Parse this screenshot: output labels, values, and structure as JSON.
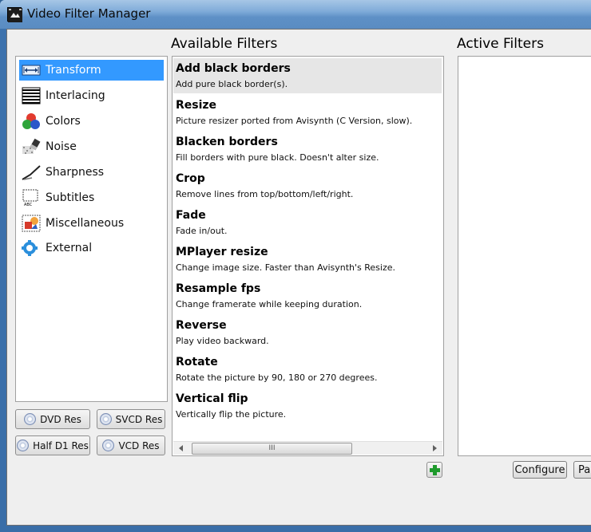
{
  "window": {
    "title": "Video Filter Manager"
  },
  "headings": {
    "available": "Available Filters",
    "active": "Active Filters"
  },
  "categories": [
    {
      "label": "Transform",
      "icon": "transform-icon",
      "selected": true
    },
    {
      "label": "Interlacing",
      "icon": "interlacing-icon"
    },
    {
      "label": "Colors",
      "icon": "colors-icon"
    },
    {
      "label": "Noise",
      "icon": "noise-icon"
    },
    {
      "label": "Sharpness",
      "icon": "sharpness-icon"
    },
    {
      "label": "Subtitles",
      "icon": "subtitles-icon"
    },
    {
      "label": "Miscellaneous",
      "icon": "miscellaneous-icon"
    },
    {
      "label": "External",
      "icon": "external-icon"
    }
  ],
  "res_buttons": {
    "dvd": "DVD Res",
    "svcd": "SVCD Res",
    "half_d1": "Half D1 Res",
    "vcd": "VCD Res"
  },
  "filters": [
    {
      "name": "Add black borders",
      "desc": "Add pure black border(s).",
      "selected": true
    },
    {
      "name": "Resize",
      "desc": "Picture resizer ported from Avisynth (C Version, slow)."
    },
    {
      "name": "Blacken borders",
      "desc": "Fill borders with pure black. Doesn't alter size."
    },
    {
      "name": "Crop",
      "desc": "Remove lines from top/bottom/left/right."
    },
    {
      "name": "Fade",
      "desc": "Fade in/out."
    },
    {
      "name": "MPlayer resize",
      "desc": "Change image size. Faster than Avisynth's Resize."
    },
    {
      "name": "Resample fps",
      "desc": "Change framerate while keeping duration."
    },
    {
      "name": "Reverse",
      "desc": "Play video backward."
    },
    {
      "name": "Rotate",
      "desc": "Rotate the picture by 90, 180 or 270 degrees."
    },
    {
      "name": "Vertical flip",
      "desc": "Vertically flip the picture."
    }
  ],
  "scrollbar": {
    "thumb_grip": "III"
  },
  "buttons": {
    "configure": "Configure",
    "partial": "Par"
  },
  "colors": {
    "selection": "#3399ff",
    "add_green": "#1e9a2c"
  }
}
